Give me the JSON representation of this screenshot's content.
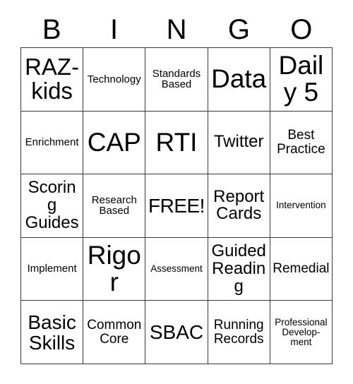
{
  "card": {
    "title": "Bingo Card",
    "header_letters": [
      "B",
      "I",
      "N",
      "G",
      "O"
    ],
    "grid_size": "5x5",
    "free_space": "FREE!",
    "colors": {
      "text": "#000000",
      "grid_line": "#3a3a3a",
      "background": "#ffffff"
    },
    "rows": [
      [
        {
          "label": "RAZ-kids",
          "size": "xl",
          "free": false
        },
        {
          "label": "Technology",
          "size": "xs",
          "free": false
        },
        {
          "label": "Standards Based",
          "size": "xs",
          "free": false
        },
        {
          "label": "Data",
          "size": "xxl",
          "free": false
        },
        {
          "label": "Daily 5",
          "size": "xxl",
          "free": false
        }
      ],
      [
        {
          "label": "Enrichment",
          "size": "xs",
          "free": false
        },
        {
          "label": "CAP",
          "size": "xxl",
          "free": false
        },
        {
          "label": "RTI",
          "size": "xxl",
          "free": false
        },
        {
          "label": "Twitter",
          "size": "md",
          "free": false
        },
        {
          "label": "Best Practice",
          "size": "sm",
          "free": false
        }
      ],
      [
        {
          "label": "Scoring Guides",
          "size": "md",
          "free": false
        },
        {
          "label": "Research Based",
          "size": "xs",
          "free": false
        },
        {
          "label": "FREE!",
          "size": "lg",
          "free": true
        },
        {
          "label": "Report Cards",
          "size": "md",
          "free": false
        },
        {
          "label": "Intervention",
          "size": "xxs",
          "free": false
        }
      ],
      [
        {
          "label": "Implement",
          "size": "xs",
          "free": false
        },
        {
          "label": "Rigor",
          "size": "xxl",
          "free": false
        },
        {
          "label": "Assessment",
          "size": "xxs",
          "free": false
        },
        {
          "label": "Guided Reading",
          "size": "md",
          "free": false
        },
        {
          "label": "Remedial",
          "size": "sm",
          "free": false
        }
      ],
      [
        {
          "label": "Basic Skills",
          "size": "lg",
          "free": false
        },
        {
          "label": "Common Core",
          "size": "sm",
          "free": false
        },
        {
          "label": "SBAC",
          "size": "lg",
          "free": false
        },
        {
          "label": "Running Records",
          "size": "sm",
          "free": false
        },
        {
          "label": "Professional Develop-ment",
          "size": "xxs",
          "free": false
        }
      ]
    ]
  }
}
